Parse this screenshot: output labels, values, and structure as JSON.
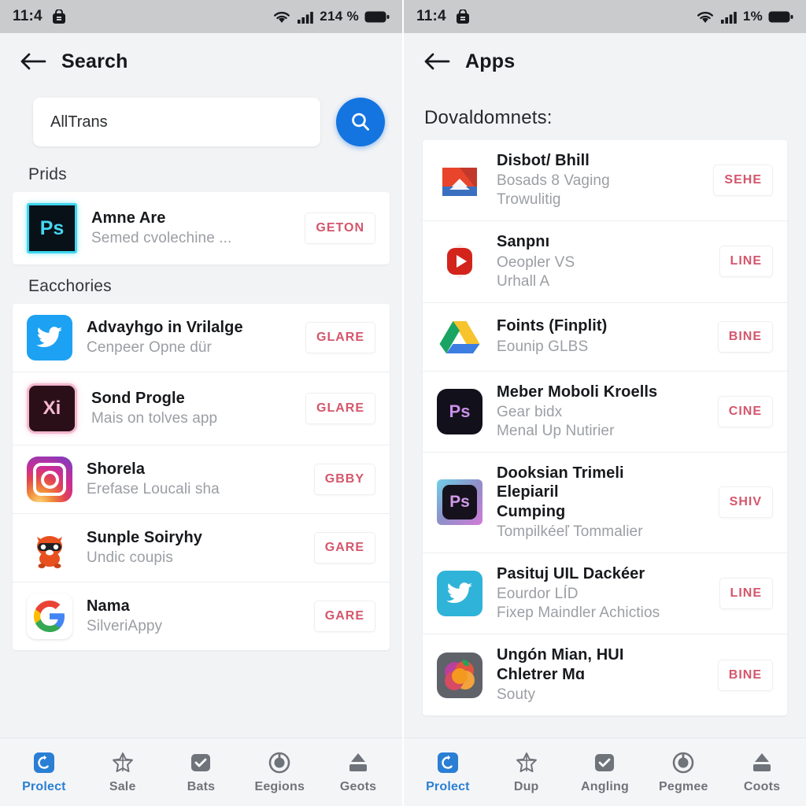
{
  "left": {
    "status": {
      "time": "11:4",
      "battery_pct": "214 %",
      "app_icon": "bag-icon",
      "wifi_icon": "wifi-icon",
      "signal_icon": "signal-icon",
      "battery_icon": "battery-icon"
    },
    "appbar": {
      "back_icon": "back-arrow-icon",
      "title": "Search"
    },
    "search": {
      "value": "AllTrans",
      "placeholder": "AllTrans",
      "button_icon": "search-icon"
    },
    "sections": [
      {
        "header": "Prids",
        "items": [
          {
            "icon": "photoshop-icon",
            "title": "Amne Are",
            "subtitle": "Semed cvolechine ...",
            "action": "GETON"
          }
        ]
      },
      {
        "header": "Eacchories",
        "items": [
          {
            "icon": "twitter-icon",
            "title": "Advayhgo in Vrilalge",
            "subtitle": "Cenpeer Opne dür",
            "action": "GLARE"
          },
          {
            "icon": "xi-icon",
            "title": "Sond Progle",
            "subtitle": "Mais on tolves app",
            "action": "GLARE"
          },
          {
            "icon": "instagram-icon",
            "title": "Shorela",
            "subtitle": "Erefase Loucali sha",
            "action": "GBBY"
          },
          {
            "icon": "cat-icon",
            "title": "Sunple Soiryhy",
            "subtitle": "Undic coupis",
            "action": "GARE"
          },
          {
            "icon": "google-icon",
            "title": "Nama",
            "subtitle": "SilveriAppy",
            "action": "GARE"
          }
        ]
      }
    ],
    "nav": [
      {
        "label": "Prolect",
        "icon": "shield-refresh-icon",
        "active": true
      },
      {
        "label": "Sale",
        "icon": "star-outline-icon",
        "active": false
      },
      {
        "label": "Bats",
        "icon": "check-square-icon",
        "active": false
      },
      {
        "label": "Eegions",
        "icon": "power-circle-icon",
        "active": false
      },
      {
        "label": "Geots",
        "icon": "upload-box-icon",
        "active": false
      }
    ]
  },
  "right": {
    "status": {
      "time": "11:4",
      "battery_pct": "1%",
      "app_icon": "bag-icon",
      "wifi_icon": "wifi-icon",
      "signal_icon": "signal-icon",
      "battery_icon": "battery-icon"
    },
    "appbar": {
      "back_icon": "back-arrow-icon",
      "title": "Apps"
    },
    "section_header": "Dovaldomnets:",
    "items": [
      {
        "icon": "mail-icon",
        "title": "Disbot/ Bhill",
        "subtitle": "Bosads 8 Vaging\nTrowulitig",
        "action": "SEHE"
      },
      {
        "icon": "youtube-icon",
        "title": "Sanpnı",
        "subtitle": "Oeopler VS\nUrhall A",
        "action": "LINE"
      },
      {
        "icon": "drive-icon",
        "title": "Foints (Finplit)",
        "subtitle": "Eounip GLBS",
        "action": "BINE"
      },
      {
        "icon": "photoshop-dark-icon",
        "title": "Meber Moboli Kroells",
        "subtitle": "Gear bidx\nMenal Up Nutirier",
        "action": "CINE"
      },
      {
        "icon": "photoshop-gradient-icon",
        "title": "Dooksian Trimeli\nElepiaril\nCumping",
        "subtitle": "Tompilkéeľ Tommalier",
        "action": "SHIV"
      },
      {
        "icon": "twitter-icon",
        "title": "Pasituj UIL Dackéer",
        "subtitle": "Eourdor LÍD\nFixep Maindler Achictios",
        "action": "LINE"
      },
      {
        "icon": "photos-icon",
        "title": "Ungón Mian, HUI\nChletrer Mɑ",
        "subtitle": "Souty",
        "action": "BINE"
      }
    ],
    "nav": [
      {
        "label": "Prolect",
        "icon": "shield-refresh-icon",
        "active": true
      },
      {
        "label": "Dup",
        "icon": "star-outline-icon",
        "active": false
      },
      {
        "label": "Angling",
        "icon": "check-square-icon",
        "active": false
      },
      {
        "label": "Pegmee",
        "icon": "power-circle-icon",
        "active": false
      },
      {
        "label": "Coots",
        "icon": "upload-box-icon",
        "active": false
      }
    ]
  },
  "colors": {
    "accent_blue": "#1474e0",
    "action_red": "#d4566c",
    "nav_active": "#2a7fd4",
    "statusbar_bg": "#c9cbcd",
    "page_bg": "#f2f3f5"
  }
}
